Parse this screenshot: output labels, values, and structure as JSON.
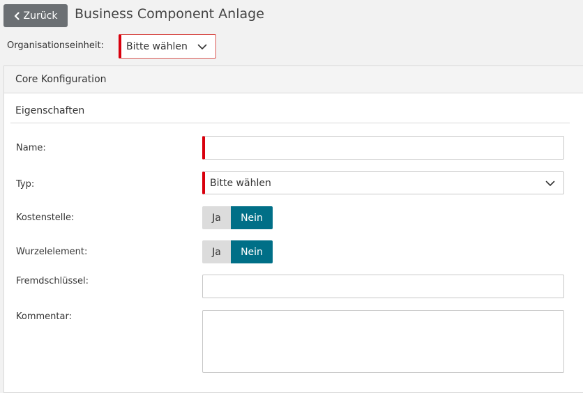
{
  "header": {
    "back_label": "Zurück",
    "title": "Business Component Anlage"
  },
  "org_unit": {
    "label": "Organisationseinheit:",
    "selected": "Bitte wählen"
  },
  "panel": {
    "title": "Core Konfiguration",
    "section_title": "Eigenschaften",
    "fields": {
      "name": {
        "label": "Name:",
        "value": ""
      },
      "typ": {
        "label": "Typ:",
        "selected": "Bitte wählen"
      },
      "kostenstelle": {
        "label": "Kostenstelle:",
        "option_yes": "Ja",
        "option_no": "Nein",
        "selected": "Nein"
      },
      "wurzelelement": {
        "label": "Wurzelelement:",
        "option_yes": "Ja",
        "option_no": "Nein",
        "selected": "Nein"
      },
      "fremdschluessel": {
        "label": "Fremdschlüssel:",
        "value": ""
      },
      "kommentar": {
        "label": "Kommentar:",
        "value": ""
      }
    }
  },
  "colors": {
    "accent": "#006f87",
    "required": "#d9000d",
    "back_button": "#6b6f73"
  },
  "icons": {
    "back": "chevron-left-icon",
    "dropdown": "chevron-down-icon"
  }
}
